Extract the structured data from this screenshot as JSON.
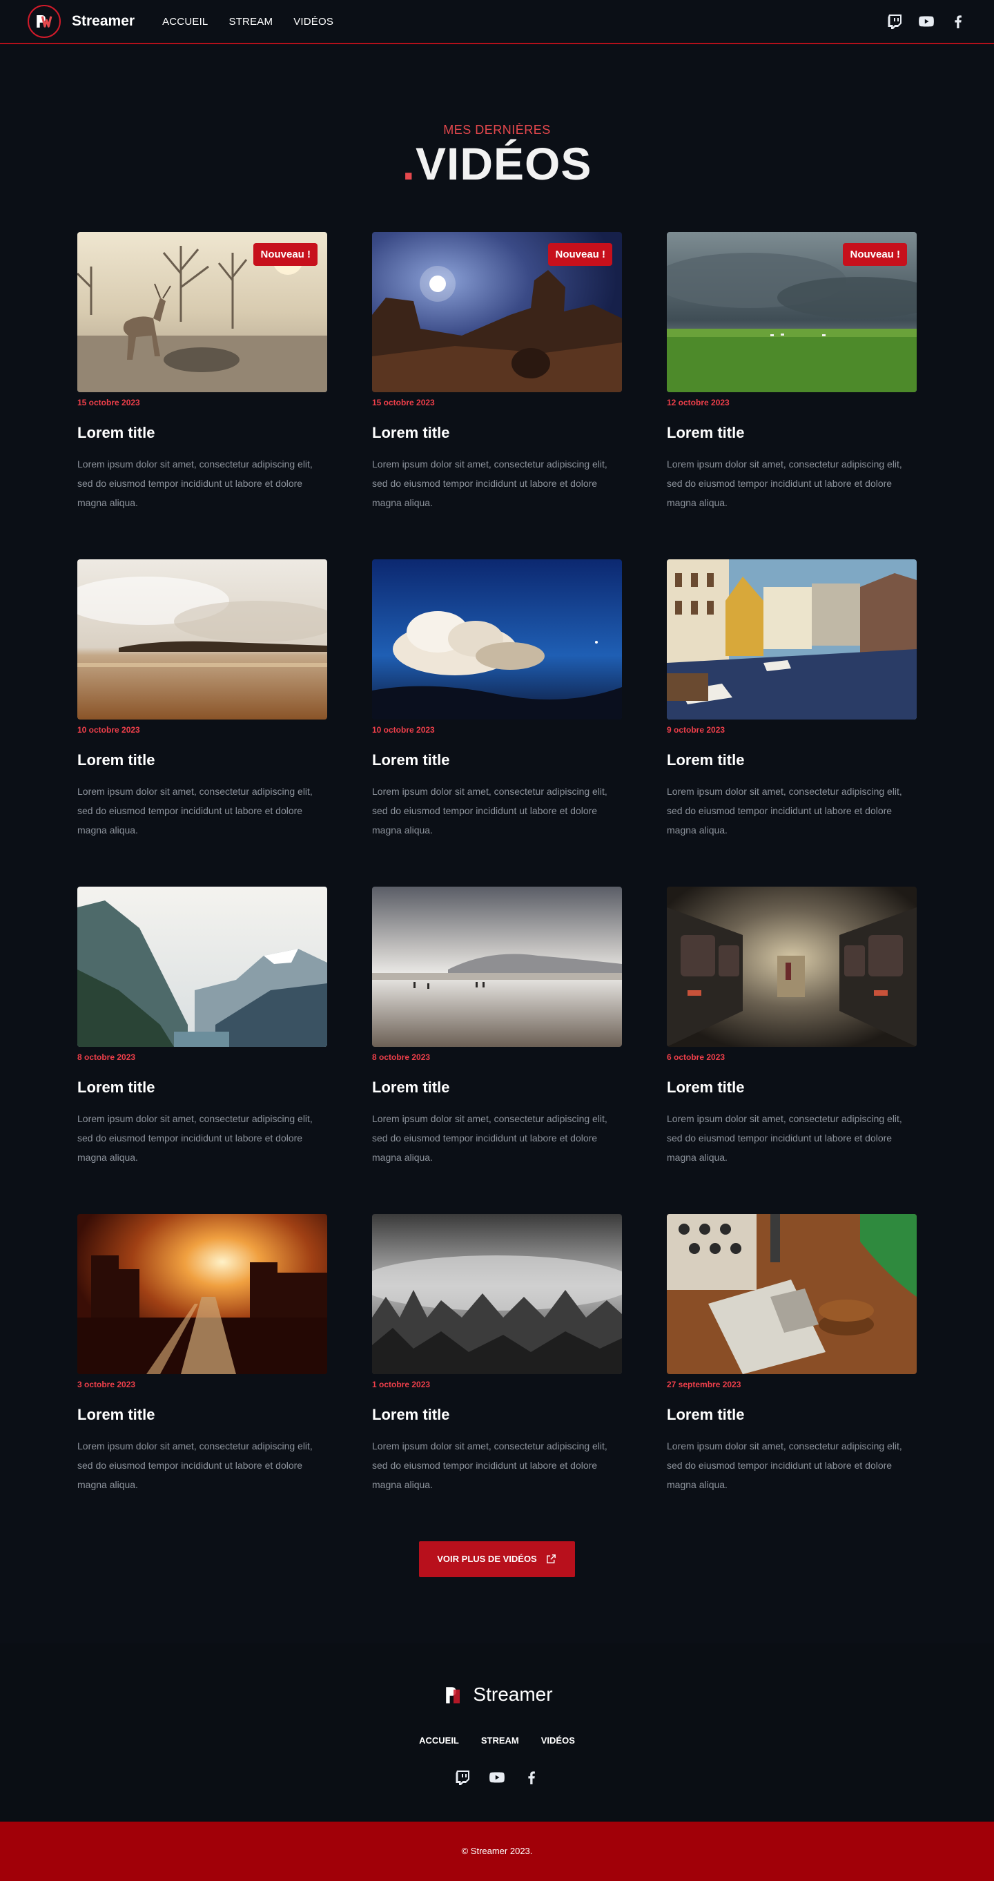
{
  "header": {
    "brand": "Streamer",
    "nav": [
      "ACCUEIL",
      "STREAM",
      "VIDÉOS"
    ],
    "social_icons": [
      "twitch-icon",
      "youtube-icon",
      "facebook-icon"
    ]
  },
  "section": {
    "eyebrow": "MES DERNIÈRES",
    "title_dot": ".",
    "title": "VIDÉOS"
  },
  "cards": [
    {
      "badge": "Nouveau !",
      "date": "15 octobre 2023",
      "title": "Lorem title",
      "text": "Lorem ipsum dolor sit amet, consectetur adipiscing elit, sed do eiusmod tempor incididunt ut labore et dolore magna aliqua.",
      "image": "deer-in-field"
    },
    {
      "badge": "Nouveau !",
      "date": "15 octobre 2023",
      "title": "Lorem title",
      "text": "Lorem ipsum dolor sit amet, consectetur adipiscing elit, sed do eiusmod tempor incididunt ut labore et dolore magna aliqua.",
      "image": "desert-night-moon"
    },
    {
      "badge": "Nouveau !",
      "date": "12 octobre 2023",
      "title": "Lorem title",
      "text": "Lorem ipsum dolor sit amet, consectetur adipiscing elit, sed do eiusmod tempor incididunt ut labore et dolore magna aliqua.",
      "image": "storm-over-meadow"
    },
    {
      "badge": "",
      "date": "10 octobre 2023",
      "title": "Lorem title",
      "text": "Lorem ipsum dolor sit amet, consectetur adipiscing elit, sed do eiusmod tempor incididunt ut labore et dolore magna aliqua.",
      "image": "sepia-beach"
    },
    {
      "badge": "",
      "date": "10 octobre 2023",
      "title": "Lorem title",
      "text": "Lorem ipsum dolor sit amet, consectetur adipiscing elit, sed do eiusmod tempor incididunt ut labore et dolore magna aliqua.",
      "image": "clouds-blue-sky"
    },
    {
      "badge": "",
      "date": "9 octobre 2023",
      "title": "Lorem title",
      "text": "Lorem ipsum dolor sit amet, consectetur adipiscing elit, sed do eiusmod tempor incididunt ut labore et dolore magna aliqua.",
      "image": "canal-city"
    },
    {
      "badge": "",
      "date": "8 octobre 2023",
      "title": "Lorem title",
      "text": "Lorem ipsum dolor sit amet, consectetur adipiscing elit, sed do eiusmod tempor incididunt ut labore et dolore magna aliqua.",
      "image": "mountain-valley"
    },
    {
      "badge": "",
      "date": "8 octobre 2023",
      "title": "Lorem title",
      "text": "Lorem ipsum dolor sit amet, consectetur adipiscing elit, sed do eiusmod tempor incididunt ut labore et dolore magna aliqua.",
      "image": "misty-beach"
    },
    {
      "badge": "",
      "date": "6 octobre 2023",
      "title": "Lorem title",
      "text": "Lorem ipsum dolor sit amet, consectetur adipiscing elit, sed do eiusmod tempor incididunt ut labore et dolore magna aliqua.",
      "image": "train-interior"
    },
    {
      "badge": "",
      "date": "3 octobre 2023",
      "title": "Lorem title",
      "text": "Lorem ipsum dolor sit amet, consectetur adipiscing elit, sed do eiusmod tempor incididunt ut labore et dolore magna aliqua.",
      "image": "city-sunset-traffic"
    },
    {
      "badge": "",
      "date": "1 octobre 2023",
      "title": "Lorem title",
      "text": "Lorem ipsum dolor sit amet, consectetur adipiscing elit, sed do eiusmod tempor incididunt ut labore et dolore magna aliqua.",
      "image": "foggy-forest"
    },
    {
      "badge": "",
      "date": "27 septembre 2023",
      "title": "Lorem title",
      "text": "Lorem ipsum dolor sit amet, consectetur adipiscing elit, sed do eiusmod tempor incididunt ut labore et dolore magna aliqua.",
      "image": "wooden-desk-book"
    }
  ],
  "more_button": {
    "label": "VOIR PLUS DE VIDÉOS",
    "icon": "external-link-icon"
  },
  "footer": {
    "brand": "Streamer",
    "nav": [
      "ACCUEIL",
      "STREAM",
      "VIDÉOS"
    ],
    "social_icons": [
      "twitch-icon",
      "youtube-icon",
      "facebook-icon"
    ],
    "copyright": "© Streamer 2023."
  },
  "colors": {
    "background": "#0b0f16",
    "accent": "#c7101c",
    "accent_text": "#e5484d",
    "footer_bar": "#a10008"
  }
}
